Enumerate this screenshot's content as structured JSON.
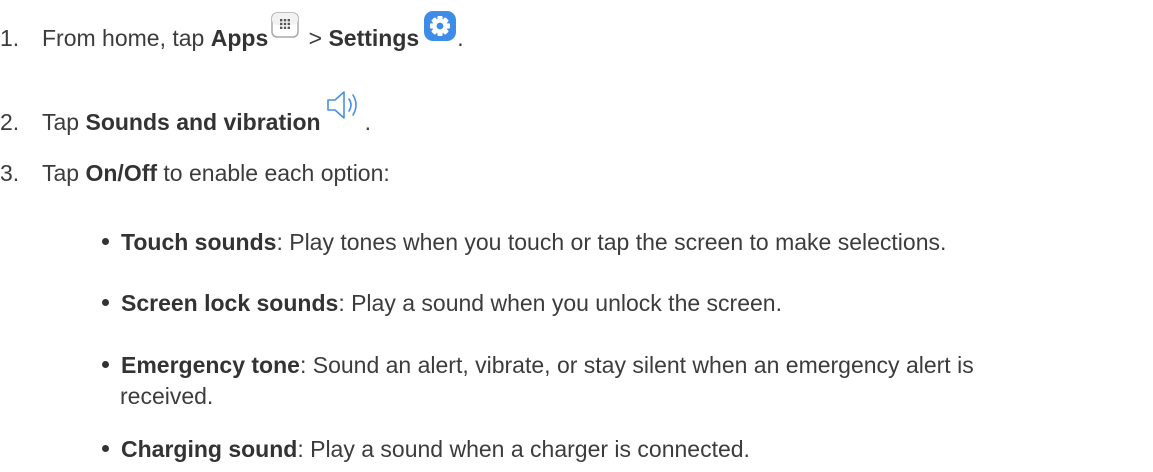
{
  "steps": [
    {
      "number": "1.",
      "text_a": "From home, tap ",
      "bold_a": "Apps",
      "text_b": " > ",
      "bold_b": "Settings",
      "text_c": ".",
      "icon_a": "apps-grid-icon",
      "icon_b": "settings-gear-icon"
    },
    {
      "number": "2.",
      "text_a": "Tap ",
      "bold_a": "Sounds and vibration",
      "text_c": ".",
      "icon_a": "speaker-sound-icon"
    },
    {
      "number": "3.",
      "text_a": "Tap ",
      "bold_a": "On/Off",
      "text_b": " to enable each option:"
    }
  ],
  "options": [
    {
      "name": "Touch sounds",
      "description": ": Play tones when you touch or tap the screen to make selections."
    },
    {
      "name": "Screen lock sounds",
      "description": ": Play a sound when you unlock the screen."
    },
    {
      "name": "Emergency tone",
      "description": ": Sound an alert, vibrate, or stay silent when an emergency alert is",
      "description_cont": "received."
    },
    {
      "name": "Charging sound",
      "description": ": Play a sound when a charger is connected."
    }
  ],
  "colors": {
    "text": "#3c3c3c",
    "settings_icon": "#3f8ce8",
    "apps_icon_border": "#a8a8a8",
    "speaker_icon": "#4a90e2"
  }
}
